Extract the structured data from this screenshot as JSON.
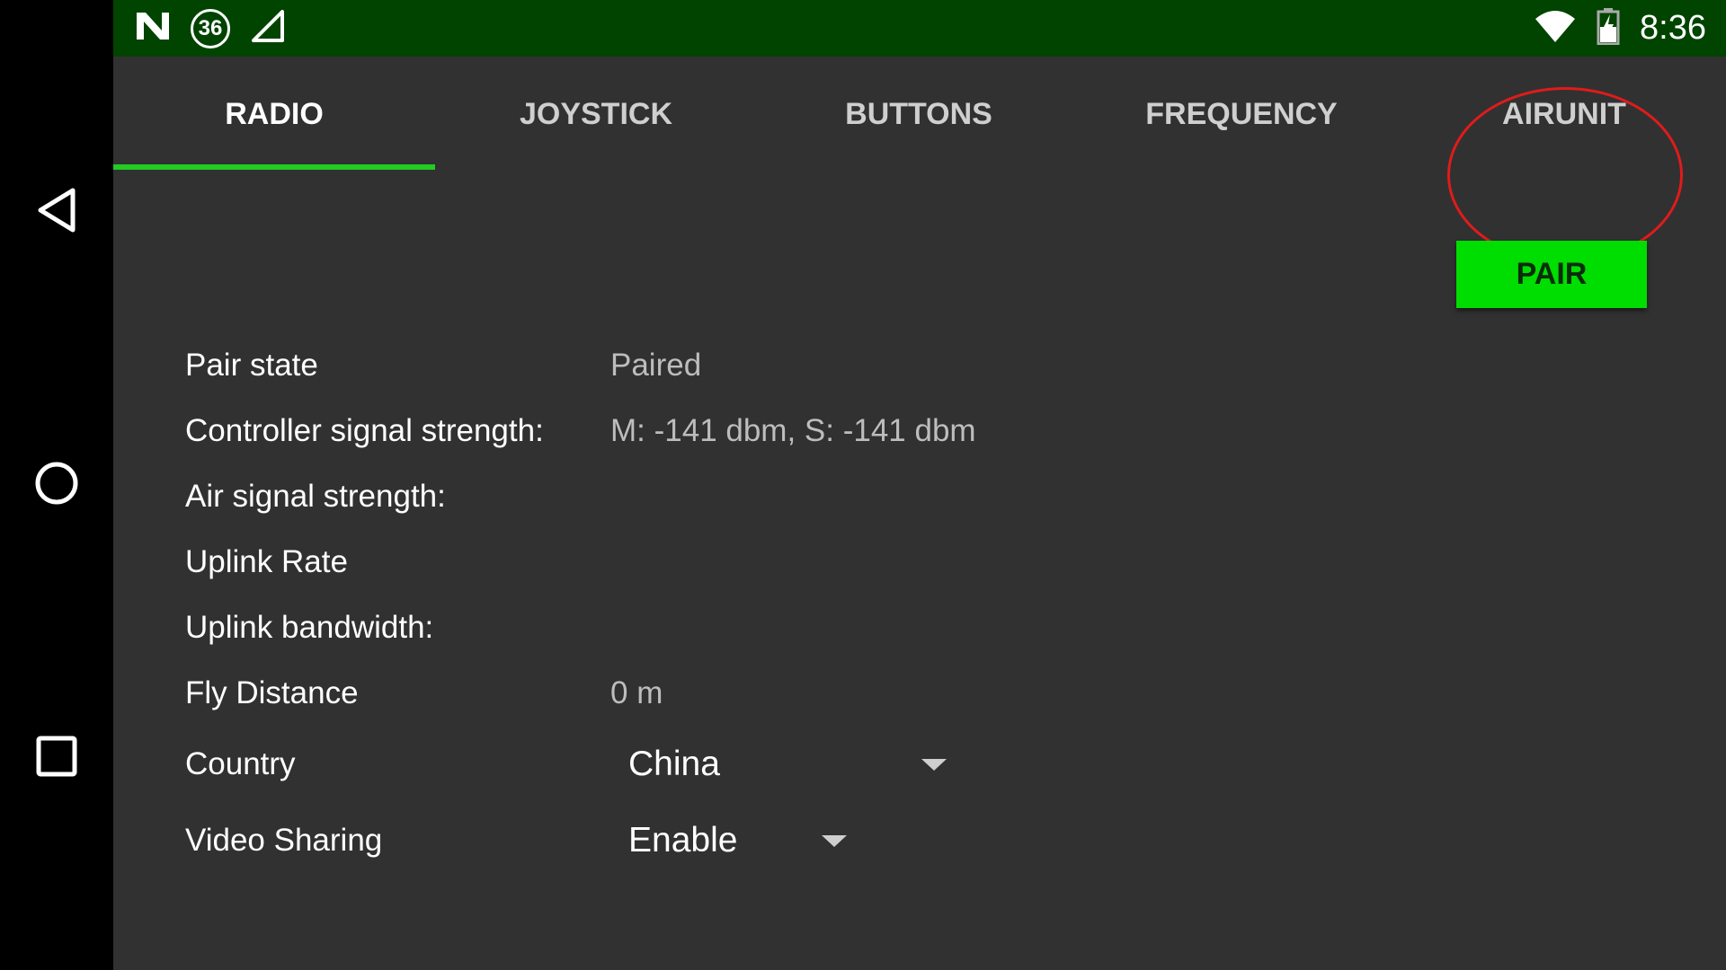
{
  "status_bar": {
    "notification_badge": "36",
    "time": "8:36",
    "icons": [
      "n-logo-icon",
      "cell-signal-icon",
      "wifi-icon",
      "battery-charging-icon"
    ]
  },
  "nav_bar": {
    "icons": [
      "back-icon",
      "home-icon",
      "recents-icon"
    ]
  },
  "tabs": [
    {
      "label": "RADIO",
      "active": true
    },
    {
      "label": "JOYSTICK",
      "active": false
    },
    {
      "label": "BUTTONS",
      "active": false
    },
    {
      "label": "FREQUENCY",
      "active": false
    },
    {
      "label": "AIRUNIT",
      "active": false
    }
  ],
  "pair_button": {
    "label": "PAIR"
  },
  "fields": {
    "pair_state": {
      "label": "Pair state",
      "value": "Paired"
    },
    "controller_signal": {
      "label": "Controller signal strength:",
      "value": "M: -141 dbm, S: -141 dbm"
    },
    "air_signal": {
      "label": "Air signal strength:",
      "value": ""
    },
    "uplink_rate": {
      "label": "Uplink Rate",
      "value": ""
    },
    "uplink_bandwidth": {
      "label": "Uplink bandwidth:",
      "value": ""
    },
    "fly_distance": {
      "label": "Fly Distance",
      "value": "0 m"
    },
    "country": {
      "label": "Country",
      "selected": "China"
    },
    "video_sharing": {
      "label": "Video Sharing",
      "selected": "Enable"
    }
  },
  "colors": {
    "accent_green": "#00dd00",
    "status_bar_bg": "#004400",
    "app_bg": "#313131",
    "annotation_red": "#e01b1b"
  }
}
